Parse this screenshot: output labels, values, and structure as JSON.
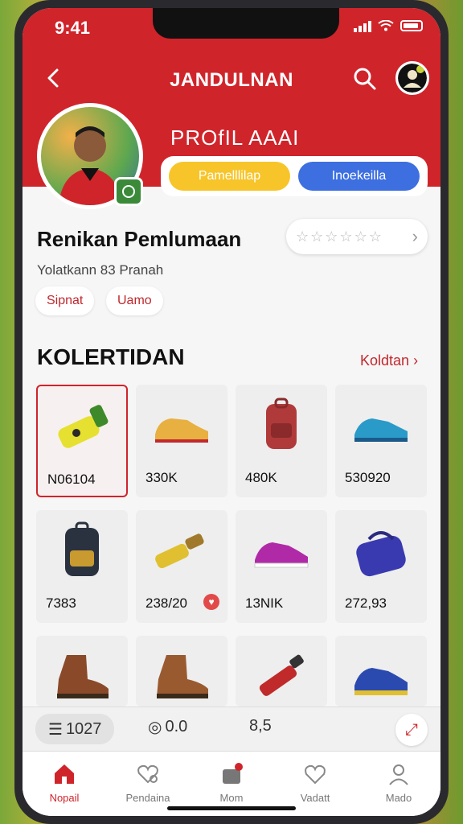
{
  "status": {
    "time": "9:41"
  },
  "nav": {
    "title": "JANDULNAN"
  },
  "profile": {
    "title": "PROfIL AAAI",
    "button_primary": "Pamelllilap",
    "button_secondary": "Inoekeilla"
  },
  "section": {
    "title": "Renikan Pemlumaan",
    "subtitle": "Yolatkann 83 Pranah",
    "rating_stars": 6
  },
  "chips": [
    "Sipnat",
    "Uamo"
  ],
  "collection": {
    "title": "KOLERTIDAN",
    "link": "Koldtan"
  },
  "items": [
    {
      "price": "N06104",
      "icon": "bottle-icon",
      "selected": true
    },
    {
      "price": "330K",
      "icon": "shoe-icon"
    },
    {
      "price": "480K",
      "icon": "backpack-icon"
    },
    {
      "price": "530920",
      "icon": "sneaker-icon"
    },
    {
      "price": "7383",
      "icon": "backpack-icon"
    },
    {
      "price": "238/20",
      "icon": "flashlight-icon",
      "fav": true
    },
    {
      "price": "13NIK",
      "icon": "sneaker-icon"
    },
    {
      "price": "272,93",
      "icon": "bag-icon"
    },
    {
      "price": "",
      "icon": "boot-icon"
    },
    {
      "price": "",
      "icon": "boot-icon"
    },
    {
      "price": "",
      "icon": "flashlight-icon"
    },
    {
      "price": "",
      "icon": "sneaker-icon"
    }
  ],
  "info_bar": {
    "left": "1027",
    "middle1": "0.0",
    "middle2": "8,5"
  },
  "tabs": [
    {
      "label": "Nopail",
      "icon": "home-icon",
      "active": true
    },
    {
      "label": "Pendaina",
      "icon": "heart-search-icon"
    },
    {
      "label": "Mom",
      "icon": "bag-notification-icon"
    },
    {
      "label": "Vadatt",
      "icon": "heart-icon"
    },
    {
      "label": "Mado",
      "icon": "user-icon"
    }
  ],
  "colors": {
    "brand_red": "#d0242b",
    "yellow": "#f7c52a",
    "blue": "#3d6fe0"
  }
}
